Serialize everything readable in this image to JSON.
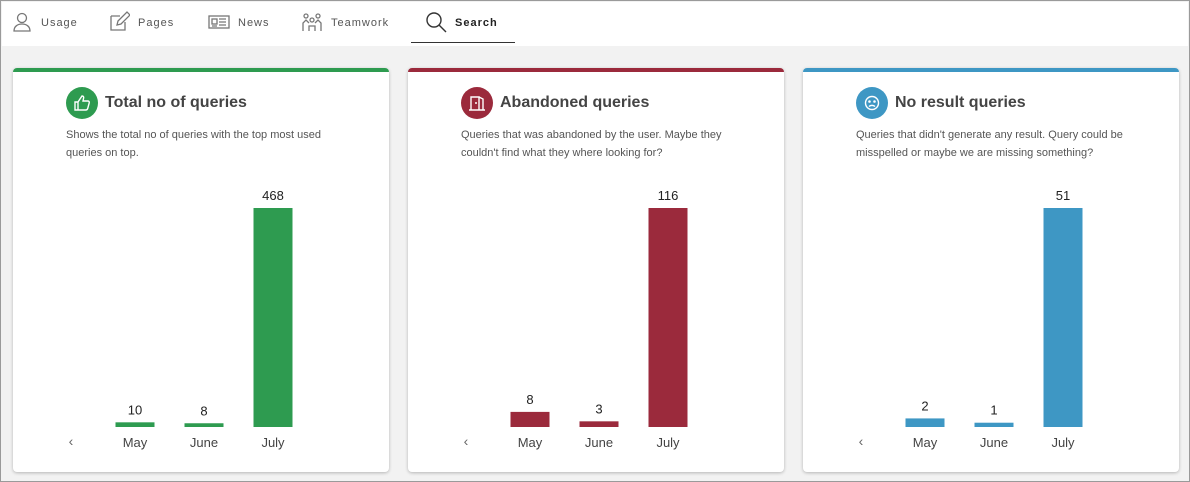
{
  "tabs": [
    {
      "label": "Usage",
      "icon": "user-icon"
    },
    {
      "label": "Pages",
      "icon": "edit-icon"
    },
    {
      "label": "News",
      "icon": "newspaper-icon"
    },
    {
      "label": "Teamwork",
      "icon": "team-icon"
    },
    {
      "label": "Search",
      "icon": "search-icon",
      "active": true
    }
  ],
  "cards": [
    {
      "title": "Total no of queries",
      "description": "Shows the total no of queries with the top most used queries on top.",
      "color": "#2e9b50",
      "icon": "thumbs-up-icon"
    },
    {
      "title": "Abandoned queries",
      "description": "Queries that was abandoned by the user. Maybe they couldn't find what they where looking for?",
      "color": "#9b2a3c",
      "icon": "exit-door-icon"
    },
    {
      "title": "No result queries",
      "description": "Queries that didn't generate any result. Query could be misspelled or maybe we are missing something?",
      "color": "#3e97c4",
      "icon": "sad-face-icon"
    }
  ],
  "chart_data": [
    {
      "type": "bar",
      "categories": [
        "May",
        "June",
        "July"
      ],
      "values": [
        10,
        8,
        468
      ],
      "color": "#2e9b50"
    },
    {
      "type": "bar",
      "categories": [
        "May",
        "June",
        "July"
      ],
      "values": [
        8,
        3,
        116
      ],
      "color": "#9b2a3c"
    },
    {
      "type": "bar",
      "categories": [
        "May",
        "June",
        "July"
      ],
      "values": [
        2,
        1,
        51
      ],
      "color": "#3e97c4"
    }
  ]
}
